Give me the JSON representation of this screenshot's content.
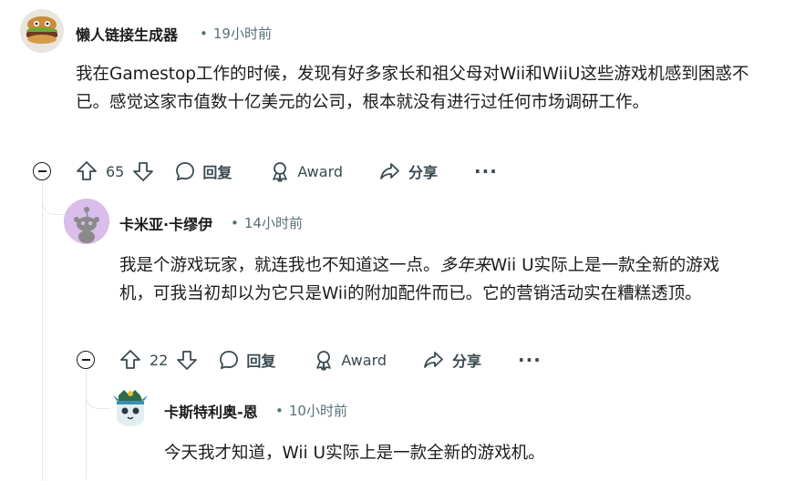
{
  "comments": [
    {
      "author": "懒人链接生成器",
      "time": "19小时前",
      "body": "我在Gamestop工作的时候，发现有好多家长和祖父母对Wii和WiiU这些游戏机感到困惑不已。感觉这家市值数十亿美元的公司，根本就没有进行过任何市场调研工作。",
      "votes": "65"
    },
    {
      "author": "卡米亚·卡缪伊",
      "time": "14小时前",
      "body_before_em": "我是个游戏玩家，就连我也不知道这一点。",
      "body_em": "多年来",
      "body_after_em": "Wii U实际上是一款全新的游戏机，可我当初却以为它只是Wii的附加配件而已。它的营销活动实在糟糕透顶。",
      "votes": "22"
    },
    {
      "author": "卡斯特利奥-恩",
      "time": "10小时前",
      "body": "今天我才知道，Wii U实际上是一款全新的游戏机。"
    }
  ],
  "actions": {
    "reply": "回复",
    "award": "Award",
    "share": "分享",
    "more": "···"
  },
  "meta_separator": "•",
  "icons": [
    "upvote-icon",
    "downvote-icon",
    "reply-icon",
    "award-icon",
    "share-icon",
    "more-icon",
    "collapse-icon"
  ]
}
